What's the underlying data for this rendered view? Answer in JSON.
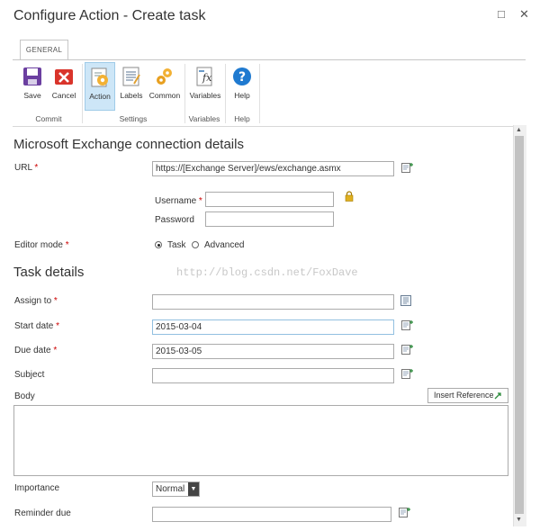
{
  "window": {
    "title": "Configure Action - Create task",
    "maximize_glyph": "□",
    "close_glyph": "✕"
  },
  "ribbon": {
    "tab": "GENERAL",
    "buttons": [
      {
        "label": "Save",
        "icon": "save-icon"
      },
      {
        "label": "Cancel",
        "icon": "cancel-icon"
      },
      {
        "label": "Action",
        "icon": "action-icon",
        "selected": true
      },
      {
        "label": "Labels",
        "icon": "labels-icon"
      },
      {
        "label": "Common",
        "icon": "common-icon"
      },
      {
        "label": "Variables",
        "icon": "variables-icon"
      },
      {
        "label": "Help",
        "icon": "help-icon"
      }
    ],
    "groups": [
      "Commit",
      "Settings",
      "Variables",
      "Help"
    ]
  },
  "connection": {
    "heading": "Microsoft Exchange connection details",
    "url_label": "URL",
    "url_value": "https://[Exchange Server]/ews/exchange.asmx",
    "username_label": "Username",
    "username_value": "",
    "password_label": "Password",
    "password_value": "",
    "editor_mode_label": "Editor mode",
    "editor_mode_options": [
      "Task",
      "Advanced"
    ],
    "editor_mode_selected": "Task"
  },
  "task": {
    "heading": "Task details",
    "assign_to_label": "Assign to",
    "assign_to_value": "",
    "start_date_label": "Start date",
    "start_date_value": "2015-03-04",
    "due_date_label": "Due date",
    "due_date_value": "2015-03-05",
    "subject_label": "Subject",
    "subject_value": "",
    "body_label": "Body",
    "insert_reference_label": "Insert Reference",
    "body_value": "",
    "importance_label": "Importance",
    "importance_value": "Normal",
    "reminder_due_label": "Reminder due",
    "reminder_due_value": ""
  },
  "required_marker": "*",
  "watermark": "http://blog.csdn.net/FoxDave",
  "colors": {
    "required": "#cc0000",
    "selected_button_bg": "#cde6f7",
    "accent": "#2a6fb0"
  }
}
